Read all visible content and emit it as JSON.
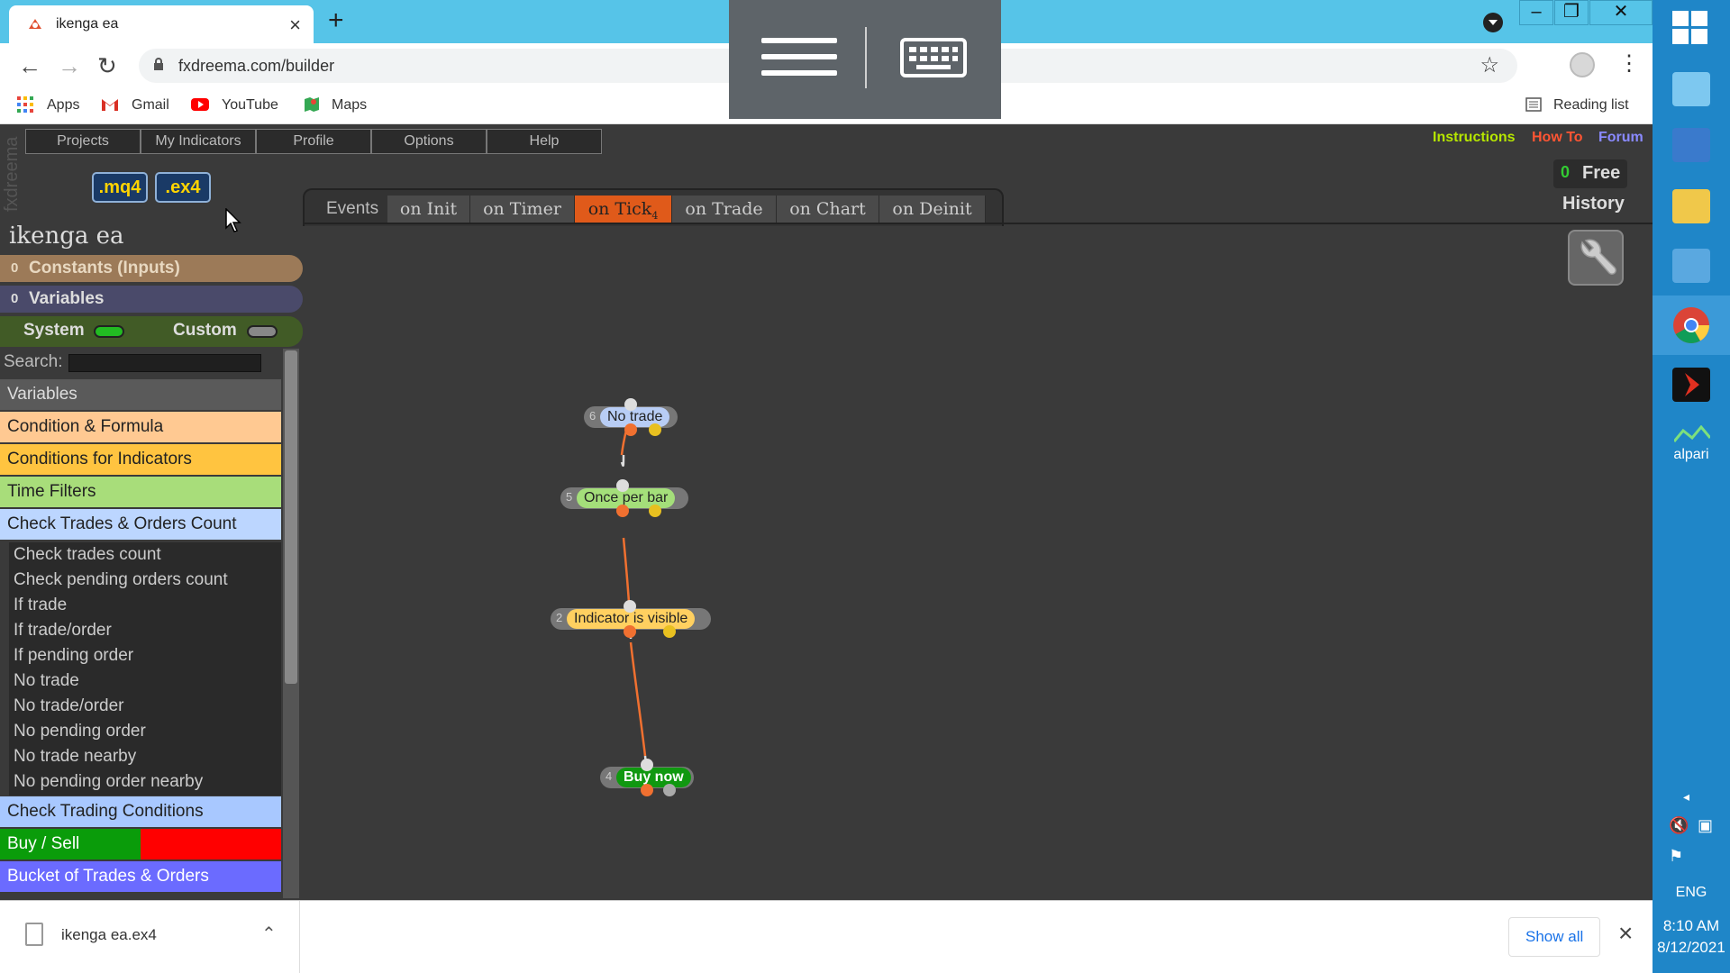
{
  "browser": {
    "tab_title": "ikenga ea",
    "new_tab_symbol": "+",
    "url": "fxdreema.com/builder",
    "bookmarks": [
      "Apps",
      "Gmail",
      "YouTube",
      "Maps"
    ],
    "reading_list": "Reading list"
  },
  "app": {
    "vertical_logo": "fxdreema",
    "menu": [
      "Projects",
      "My Indicators",
      "Profile",
      "Options",
      "Help"
    ],
    "top_links": [
      "Instructions",
      "How To",
      "Forum"
    ],
    "file_buttons": [
      ".mq4",
      ".ex4"
    ],
    "project_title": "ikenga ea",
    "sections": {
      "constants": "Constants (Inputs)",
      "variables": "Variables",
      "constants_count": "0",
      "variables_count": "0"
    },
    "system_label": "System",
    "custom_label": "Custom",
    "search_label": "Search:",
    "search_value": "",
    "categories": [
      {
        "label": "Variables",
        "bg": "#5a5a5a",
        "color": "#dddddd"
      },
      {
        "label": "Condition & Formula",
        "bg": "#ffc992",
        "color": "#222222"
      },
      {
        "label": "Conditions for Indicators",
        "bg": "#ffc440",
        "color": "#222222"
      },
      {
        "label": "Time Filters",
        "bg": "#a8dd7a",
        "color": "#222222"
      },
      {
        "label": "Check Trades & Orders Count",
        "bg": "#bcd6ff",
        "color": "#222222"
      }
    ],
    "subitems": [
      "Check trades count",
      "Check pending orders count",
      "If trade",
      "If trade/order",
      "If pending order",
      "No trade",
      "No trade/order",
      "No pending order",
      "No trade nearby",
      "No pending order nearby"
    ],
    "categories_after": [
      {
        "label": "Check Trading Conditions",
        "bg": "#a8c8ff",
        "color": "#222222"
      },
      {
        "label": "Buy / Sell",
        "bg": "#0a9c0a",
        "color": "#ffffff"
      },
      {
        "label": "Bucket of Trades & Orders",
        "bg": "#6b6bff",
        "color": "#ffffff"
      }
    ],
    "events_label": "Events",
    "event_tabs": [
      "on Init",
      "on Timer",
      "on Tick",
      "on Trade",
      "on Chart",
      "on Deinit"
    ],
    "active_event": "on Tick",
    "active_event_count": "4",
    "free_count": "0",
    "free_label": "Free",
    "history_label": "History",
    "blocks": [
      {
        "id": "6",
        "label": "No trade",
        "color": "#b8cdf5",
        "text_color": "#222222"
      },
      {
        "id": "5",
        "label": "Once per bar",
        "color": "#a4df7a",
        "text_color": "#222222"
      },
      {
        "id": "2",
        "label": "Indicator is visible",
        "color": "#ffd060",
        "text_color": "#222222"
      },
      {
        "id": "4",
        "label": "Buy now",
        "color": "#109810",
        "text_color": "#ffffff"
      }
    ],
    "colors": {
      "instructions": "#b6e600",
      "howto": "#ff5533",
      "forum": "#8a8aff",
      "active_tab": "#e05a1a",
      "connector": "#f07030"
    }
  },
  "downloads": {
    "file": "ikenga ea.ex4",
    "show_all": "Show all"
  },
  "taskbar": {
    "tray_lang": "ENG",
    "time": "8:10 AM",
    "date": "8/12/2021",
    "alpari_label": "alpari"
  }
}
